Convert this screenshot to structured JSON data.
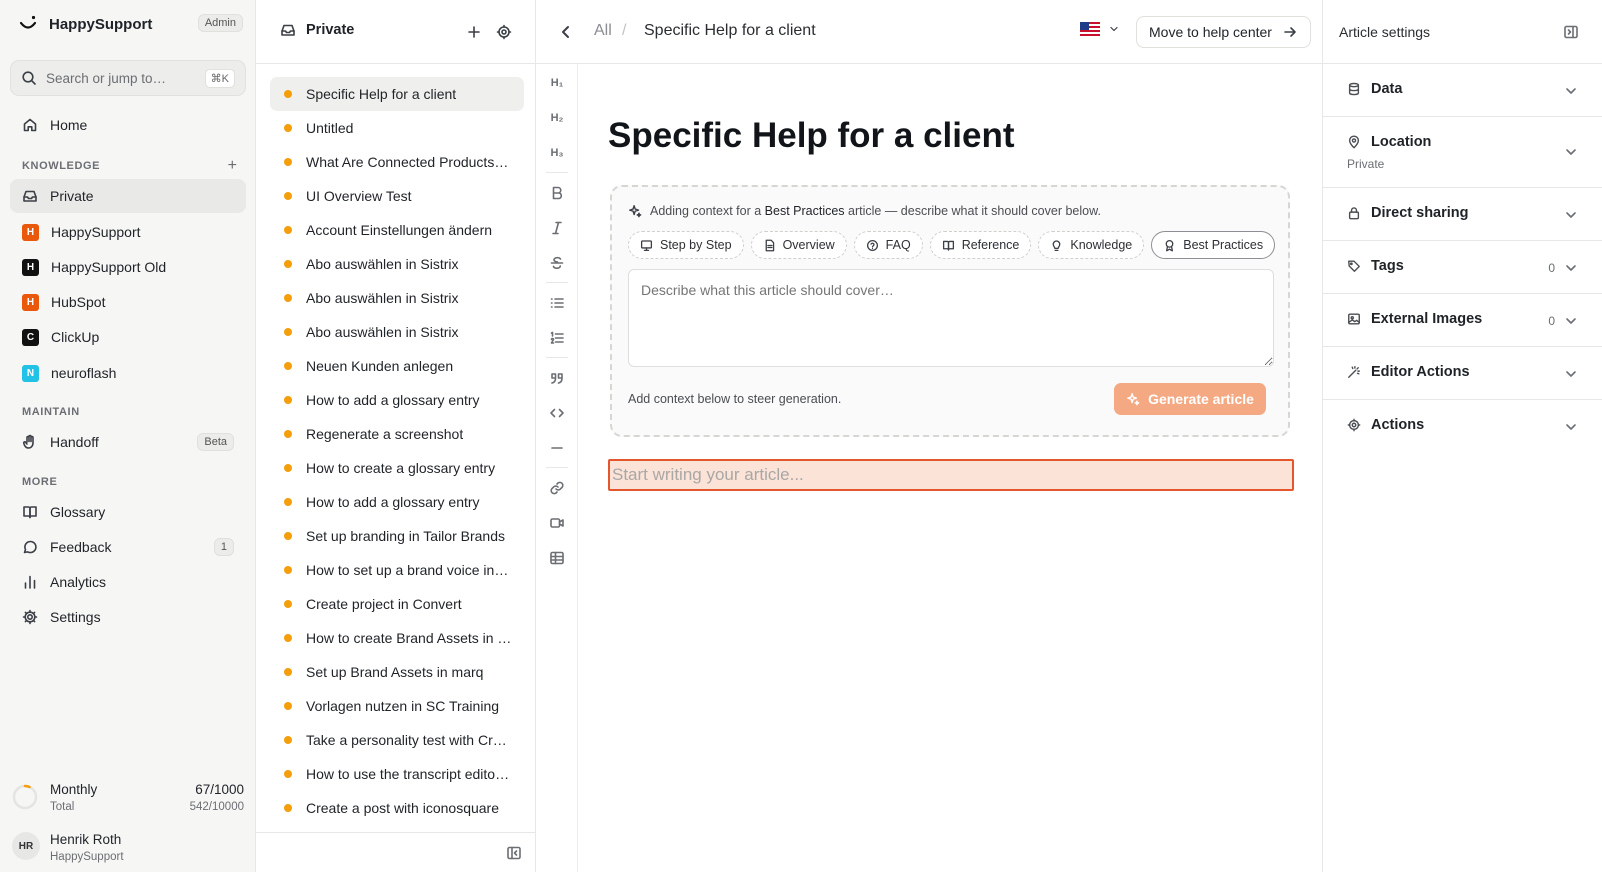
{
  "app": {
    "name": "HappySupport",
    "role_badge": "Admin",
    "search_placeholder": "Search or jump to…",
    "search_shortcut": "⌘K"
  },
  "nav": {
    "home": "Home",
    "knowledge_label": "KNOWLEDGE",
    "private": "Private",
    "workspaces": [
      {
        "letter": "H",
        "label": "HappySupport",
        "color": "#ea580c"
      },
      {
        "letter": "H",
        "label": "HappySupport Old",
        "color": "#111111"
      },
      {
        "letter": "H",
        "label": "HubSpot",
        "color": "#ea580c"
      },
      {
        "letter": "C",
        "label": "ClickUp",
        "color": "#111111"
      },
      {
        "letter": "N",
        "label": "neuroflash",
        "color": "#22c1e6"
      }
    ],
    "maintain_label": "MAINTAIN",
    "handoff": "Handoff",
    "handoff_badge": "Beta",
    "more_label": "MORE",
    "glossary": "Glossary",
    "feedback": "Feedback",
    "feedback_count": "1",
    "analytics": "Analytics",
    "settings": "Settings"
  },
  "usage": {
    "label": "Monthly",
    "sub_label": "Total",
    "monthly": "67/1000",
    "total": "542/10000",
    "monthly_fraction": 0.067
  },
  "user": {
    "initials": "HR",
    "name": "Henrik Roth",
    "org": "HappySupport"
  },
  "list": {
    "title": "Private",
    "items": [
      "Specific Help for a client",
      "Untitled",
      "What Are Connected Products…",
      "UI Overview Test",
      "Account Einstellungen ändern",
      "Abo auswählen in Sistrix",
      "Abo auswählen in Sistrix",
      "Abo auswählen in Sistrix",
      "Neuen Kunden anlegen",
      "How to add a glossary entry",
      "Regenerate a screenshot",
      "How to create a glossary entry",
      "How to add a glossary entry",
      "Set up branding in Tailor Brands",
      "How to set up a brand voice in …",
      "Create project in Convert",
      "How to create Brand Assets in …",
      "Set up Brand Assets in marq",
      "Vorlagen nutzen in SC Training",
      "Take a personality test with Cry…",
      "How to use the transcript editor…",
      "Create a post with iconosquare"
    ]
  },
  "topbar": {
    "crumb_all": "All",
    "crumb_sep": "/",
    "crumb_current": "Specific Help for a client",
    "lang_flag": "🇺🇸",
    "move_button": "Move to help center"
  },
  "toolbar": {
    "h1": "H₁",
    "h2": "H₂",
    "h3": "H₃"
  },
  "editor": {
    "title": "Specific Help for a client",
    "context_prefix": "Adding context for a ",
    "context_type": "Best Practices",
    "context_suffix": " article — describe what it should cover below.",
    "chips": [
      "Step by Step",
      "Overview",
      "FAQ",
      "Reference",
      "Knowledge",
      "Best Practices"
    ],
    "textarea_placeholder": "Describe what this article should cover…",
    "hint": "Add context below to steer generation.",
    "generate_button": "Generate article",
    "write_placeholder": "Start writing your article..."
  },
  "settings": {
    "title": "Article settings",
    "sections": {
      "data": "Data",
      "location": "Location",
      "location_value": "Private",
      "direct_sharing": "Direct sharing",
      "tags": "Tags",
      "tags_count": "0",
      "external_images": "External Images",
      "external_images_count": "0",
      "editor_actions": "Editor Actions",
      "actions": "Actions"
    }
  }
}
